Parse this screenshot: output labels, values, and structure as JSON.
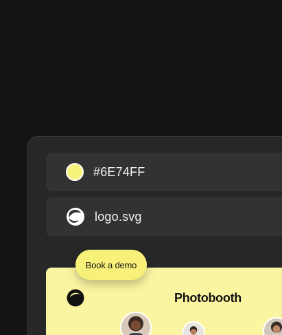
{
  "brand_settings": {
    "color_row": {
      "swatch_color": "#F6F27A",
      "value": "#6E74FF"
    },
    "logo_row": {
      "icon": "logo-mark-icon",
      "filename": "logo.svg"
    }
  },
  "cta": {
    "label": "Book a demo",
    "color": "#F7F17A"
  },
  "preview": {
    "background": "#FBF5A2",
    "title": "Photobooth",
    "logo_icon": "logo-mark-icon",
    "avatars": [
      {
        "icon": "person-avatar"
      },
      {
        "icon": "person-avatar"
      },
      {
        "icon": "person-avatar"
      }
    ]
  },
  "theme": {
    "page_background": "#141414",
    "panel_background": "#272727",
    "row_background": "#323232"
  }
}
